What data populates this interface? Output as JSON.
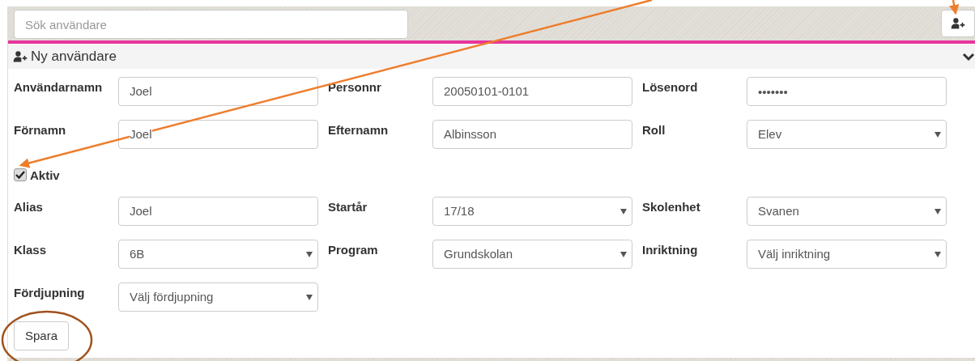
{
  "search": {
    "placeholder": "Sök användare"
  },
  "panel": {
    "title": "Ny användare",
    "expanded": true
  },
  "rows": [
    [
      {
        "label": "Användarnamn",
        "kind": "text",
        "value": "Joel"
      },
      {
        "label": "Personnr",
        "kind": "text",
        "value": "20050101-0101"
      },
      {
        "label": "Lösenord",
        "kind": "password",
        "value": "•••••••"
      }
    ],
    [
      {
        "label": "Förnamn",
        "kind": "text",
        "value": "Joel"
      },
      {
        "label": "Efternamn",
        "kind": "text",
        "value": "Albinsson"
      },
      {
        "label": "Roll",
        "kind": "select",
        "value": "Elev"
      }
    ],
    [
      {
        "label": "Aktiv",
        "kind": "checkbox",
        "checked": true
      }
    ],
    [
      {
        "label": "Alias",
        "kind": "text",
        "value": "Joel"
      },
      {
        "label": "Startår",
        "kind": "select",
        "value": "17/18"
      },
      {
        "label": "Skolenhet",
        "kind": "select",
        "value": "Svanen"
      }
    ],
    [
      {
        "label": "Klass",
        "kind": "select",
        "value": "6B"
      },
      {
        "label": "Program",
        "kind": "select",
        "value": "Grundskolan"
      },
      {
        "label": "Inriktning",
        "kind": "select",
        "value": "Välj inriktning"
      }
    ],
    [
      {
        "label": "Fördjupning",
        "kind": "select",
        "value": "Välj fördjupning"
      }
    ]
  ],
  "save_button": "Spara"
}
